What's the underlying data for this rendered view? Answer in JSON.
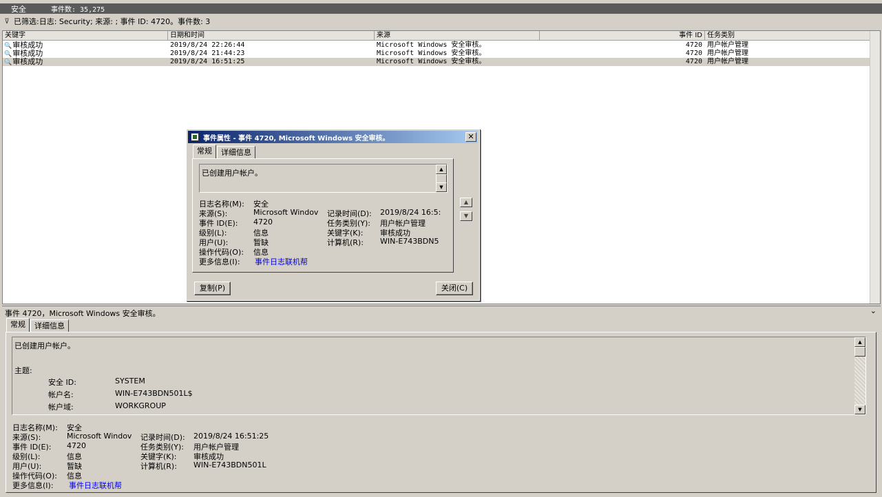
{
  "header": {
    "log_name": "安全",
    "event_count_label": "事件数: 35,275"
  },
  "filter": {
    "icon": "funnel-icon",
    "text": "已筛选:日志: Security; 来源: ; 事件 ID: 4720。事件数: 3"
  },
  "table": {
    "columns": [
      "关键字",
      "日期和时间",
      "来源",
      "事件 ID",
      "任务类别"
    ],
    "rows": [
      {
        "keyword": "审核成功",
        "datetime": "2019/8/24 22:26:44",
        "source": "Microsoft Windows 安全审核。",
        "event_id": "4720",
        "task": "用户帐户管理"
      },
      {
        "keyword": "审核成功",
        "datetime": "2019/8/24 21:44:23",
        "source": "Microsoft Windows 安全审核。",
        "event_id": "4720",
        "task": "用户帐户管理"
      },
      {
        "keyword": "审核成功",
        "datetime": "2019/8/24 16:51:25",
        "source": "Microsoft Windows 安全审核。",
        "event_id": "4720",
        "task": "用户帐户管理"
      }
    ],
    "selected_index": 2
  },
  "dialog": {
    "title": "事件属性 - 事件 4720, Microsoft Windows 安全审核。",
    "close_glyph": "✕",
    "tabs": [
      "常规",
      "详细信息"
    ],
    "message": "已创建用户帐户。",
    "props": {
      "log_name_label": "日志名称(M):",
      "log_name": "安全",
      "source_label": "来源(S):",
      "source": "Microsoft Windov",
      "record_time_label": "记录时间(D):",
      "record_time": "2019/8/24 16:5:",
      "event_id_label": "事件 ID(E):",
      "event_id": "4720",
      "task_label": "任务类别(Y):",
      "task": "用户帐户管理",
      "level_label": "级别(L):",
      "level": "信息",
      "keyword_label": "关键字(K):",
      "keyword": "审核成功",
      "user_label": "用户(U):",
      "user": "暂缺",
      "computer_label": "计算机(R):",
      "computer": "WIN-E743BDN5",
      "opcode_label": "操作代码(O):",
      "opcode": "信息",
      "more_info_label": "更多信息(I):",
      "more_info_link": "事件日志联机帮"
    },
    "copy_button": "复制(P)",
    "close_button": "关闭(C)"
  },
  "preview": {
    "title": "事件 4720，Microsoft Windows 安全审核。",
    "collapse_glyph": "⌄",
    "tabs": [
      "常规",
      "详细信息"
    ],
    "message": "已创建用户帐户。",
    "subject_label": "主题:",
    "subject": [
      {
        "label": "安全 ID:",
        "value": "SYSTEM"
      },
      {
        "label": "帐户名:",
        "value": "WIN-E743BDN501L$"
      },
      {
        "label": "帐户域:",
        "value": "WORKGROUP"
      }
    ],
    "props": {
      "log_name_label": "日志名称(M):",
      "log_name": "安全",
      "source_label": "来源(S):",
      "source": "Microsoft Windov",
      "record_time_label": "记录时间(D):",
      "record_time": "2019/8/24 16:51:25",
      "event_id_label": "事件 ID(E):",
      "event_id": "4720",
      "task_label": "任务类别(Y):",
      "task": "用户帐户管理",
      "level_label": "级别(L):",
      "level": "信息",
      "keyword_label": "关键字(K):",
      "keyword": "审核成功",
      "user_label": "用户(U):",
      "user": "暂缺",
      "computer_label": "计算机(R):",
      "computer": "WIN-E743BDN501L",
      "opcode_label": "操作代码(O):",
      "opcode": "信息",
      "more_info_label": "更多信息(I):",
      "more_info_link": "事件日志联机帮"
    }
  },
  "colors": {
    "selection": "#d4d0c8",
    "link": "#0000ee",
    "dialog_title": "#0a246a"
  }
}
